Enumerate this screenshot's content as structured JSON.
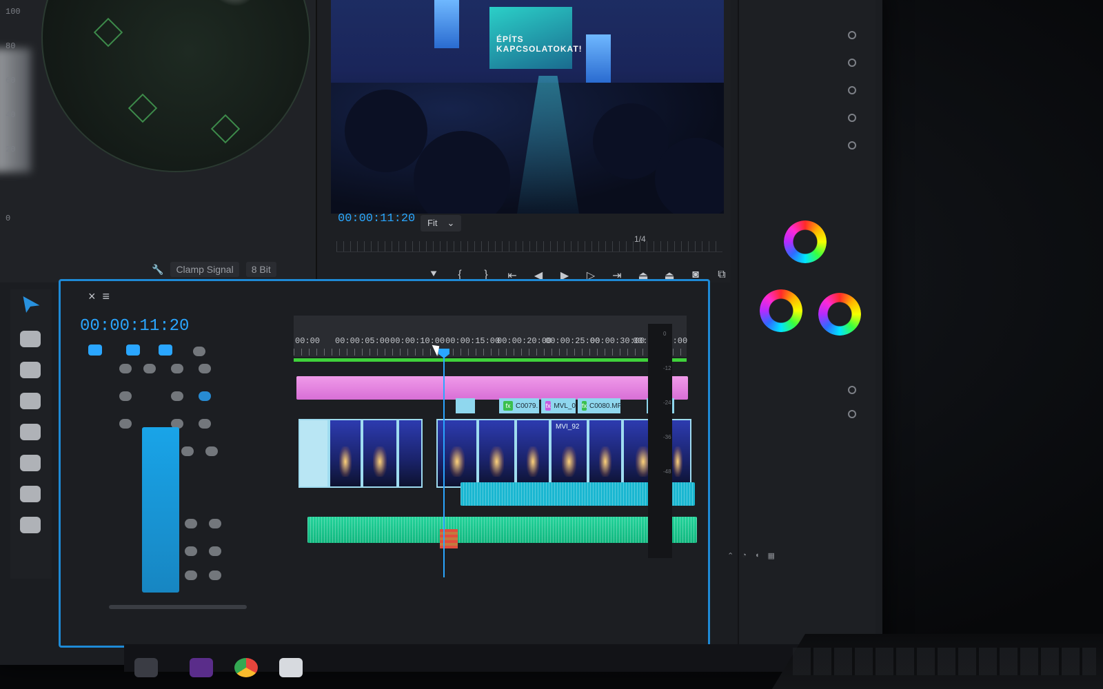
{
  "program_monitor": {
    "timecode": "00:00:11:20",
    "zoom": "Fit",
    "resolution": "1/4",
    "stage_text_line1": "ÉPÍTS",
    "stage_text_line2": "KAPCSOLATOKAT!"
  },
  "scope": {
    "footer_label": "Clamp Signal",
    "footer_value": "8 Bit"
  },
  "timeline": {
    "timecode": "00:00:11:20",
    "ruler_labels": [
      "00:00",
      "00:00:05:00",
      "00:00:10:00",
      "00:00:15:00",
      "00:00:20:00",
      "00:00:25:00",
      "00:00:30:00",
      "00:00:35:00"
    ],
    "clips": [
      {
        "label": "C0079.",
        "fx": "green"
      },
      {
        "label": "MVL_0",
        "fx": "purple"
      },
      {
        "label": "C0080.MP",
        "fx": "green"
      },
      {
        "label": "MVI_92",
        "fx": "purple"
      }
    ]
  },
  "colors": {
    "accent": "#2aa6ff",
    "work_area": "#3fd13b",
    "adjustment": "#e88ae4",
    "audio": "#1ec491"
  },
  "icons": [
    "selection-tool-icon",
    "wrench-icon",
    "play-icon",
    "step-back-icon",
    "step-forward-icon",
    "marker-icon",
    "camera-icon"
  ]
}
